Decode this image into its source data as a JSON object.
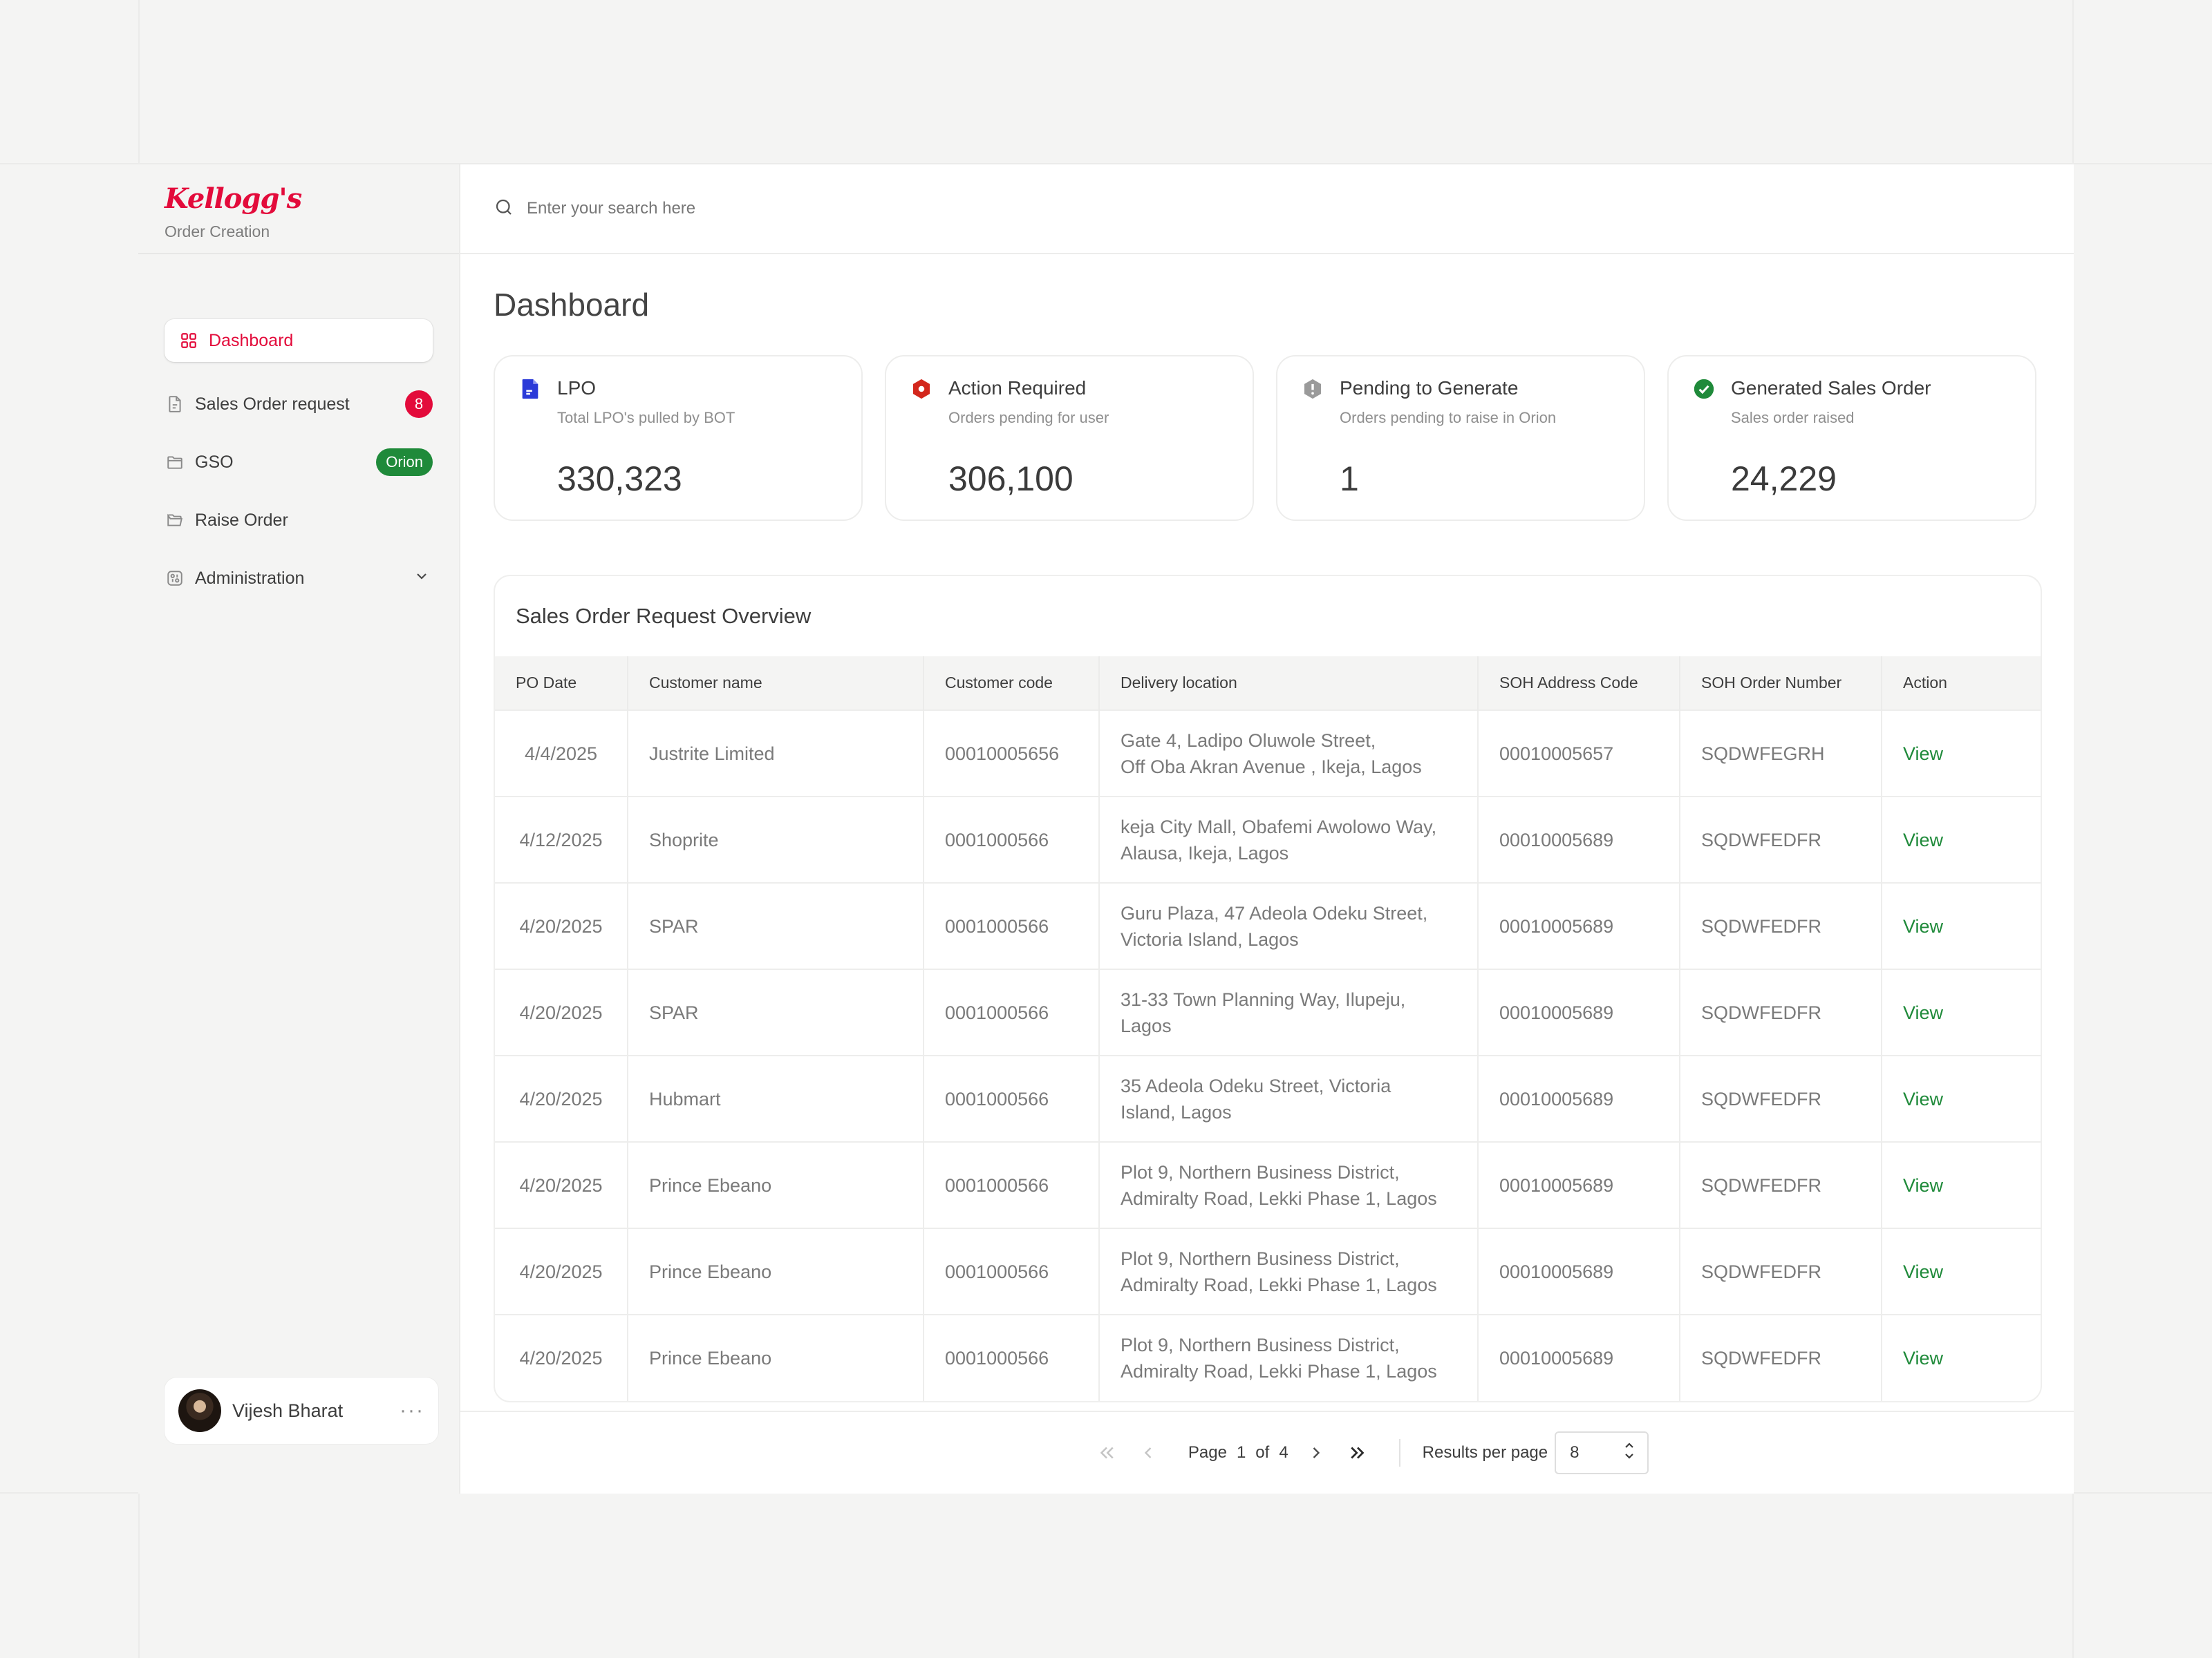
{
  "brand": {
    "logo": "Kellogg's",
    "subtitle": "Order Creation"
  },
  "sidebar": {
    "items": [
      {
        "label": "Dashboard",
        "icon": "grid-icon"
      },
      {
        "label": "Sales Order request",
        "icon": "document-icon",
        "badge": "8"
      },
      {
        "label": "GSO",
        "icon": "folder-icon",
        "badge": "Orion"
      },
      {
        "label": "Raise Order",
        "icon": "folder-open-icon"
      },
      {
        "label": "Administration",
        "icon": "admin-icon"
      }
    ]
  },
  "user": {
    "name": "Vijesh Bharat"
  },
  "search": {
    "placeholder": "Enter your search here"
  },
  "page_title": "Dashboard",
  "cards": [
    {
      "title": "LPO",
      "subtitle": "Total LPO's pulled by BOT",
      "value": "330,323",
      "color": "#2b3ad8"
    },
    {
      "title": "Action Required",
      "subtitle": "Orders pending for user",
      "value": "306,100",
      "color": "#d3271c"
    },
    {
      "title": "Pending to Generate",
      "subtitle": "Orders pending to raise in Orion",
      "value": "1",
      "color": "#9a9a9a"
    },
    {
      "title": "Generated Sales Order",
      "subtitle": "Sales order raised",
      "value": "24,229",
      "color": "#1f8a3a"
    }
  ],
  "table": {
    "title": "Sales Order Request Overview",
    "columns": [
      "PO Date",
      "Customer name",
      "Customer code",
      "Delivery location",
      "SOH Address Code",
      "SOH Order Number",
      "Action"
    ],
    "rows": [
      {
        "date": "4/4/2025",
        "customer": "Justrite Limited",
        "code": "00010005656",
        "loc1": "Gate 4, Ladipo Oluwole Street,",
        "loc2": "Off Oba Akran Avenue , Ikeja, Lagos",
        "soh_code": "00010005657",
        "soh_number": "SQDWFEGRH",
        "action": "View"
      },
      {
        "date": "4/12/2025",
        "customer": "Shoprite",
        "code": "0001000566",
        "loc1": "keja City Mall, Obafemi Awolowo Way,",
        "loc2": "Alausa, Ikeja, Lagos",
        "soh_code": "00010005689",
        "soh_number": "SQDWFEDFR",
        "action": "View"
      },
      {
        "date": "4/20/2025",
        "customer": "SPAR",
        "code": "0001000566",
        "loc1": "Guru Plaza, 47 Adeola Odeku Street,",
        "loc2": "Victoria Island, Lagos",
        "soh_code": "00010005689",
        "soh_number": "SQDWFEDFR",
        "action": "View"
      },
      {
        "date": "4/20/2025",
        "customer": "SPAR",
        "code": "0001000566",
        "loc1": "31-33 Town Planning Way, Ilupeju,",
        "loc2": "Lagos",
        "soh_code": "00010005689",
        "soh_number": "SQDWFEDFR",
        "action": "View"
      },
      {
        "date": "4/20/2025",
        "customer": "Hubmart",
        "code": "0001000566",
        "loc1": "35 Adeola Odeku Street, Victoria",
        "loc2": "Island, Lagos",
        "soh_code": "00010005689",
        "soh_number": "SQDWFEDFR",
        "action": "View"
      },
      {
        "date": "4/20/2025",
        "customer": "Prince Ebeano",
        "code": "0001000566",
        "loc1": "Plot 9, Northern Business District,",
        "loc2": "Admiralty Road, Lekki Phase 1, Lagos",
        "soh_code": "00010005689",
        "soh_number": "SQDWFEDFR",
        "action": "View"
      },
      {
        "date": "4/20/2025",
        "customer": "Prince Ebeano",
        "code": "0001000566",
        "loc1": "Plot 9, Northern Business District,",
        "loc2": "Admiralty Road, Lekki Phase 1, Lagos",
        "soh_code": "00010005689",
        "soh_number": "SQDWFEDFR",
        "action": "View"
      },
      {
        "date": "4/20/2025",
        "customer": "Prince Ebeano",
        "code": "0001000566",
        "loc1": "Plot 9, Northern Business District,",
        "loc2": "Admiralty Road, Lekki Phase 1, Lagos",
        "soh_code": "00010005689",
        "soh_number": "SQDWFEDFR",
        "action": "View"
      }
    ]
  },
  "pagination": {
    "page_label": "Page",
    "current": "1",
    "of_label": "of",
    "total": "4",
    "rpp_label": "Results per page",
    "rpp_value": "8"
  }
}
